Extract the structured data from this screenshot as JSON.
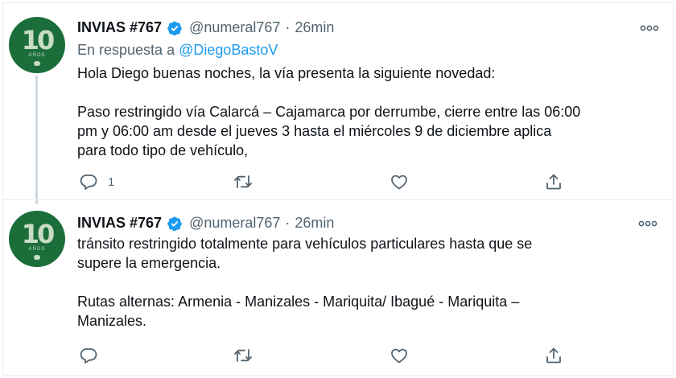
{
  "tweets": [
    {
      "author_name": "INVIAS #767",
      "handle": "@numeral767",
      "separator": "·",
      "time": "26min",
      "reply_prefix": "En respuesta a",
      "reply_mention": "@DiegoBastoV",
      "body_lines": [
        "Hola Diego buenas noches, la vía presenta la siguiente novedad:",
        "Paso restringido vía Calarcá – Cajamarca por derrumbe, cierre entre las 06:00",
        "pm y 06:00 am desde el jueves 3 hasta el miércoles 9 de diciembre aplica",
        "para todo tipo de vehículo,"
      ],
      "reply_count": "1",
      "avatar_text": "10",
      "avatar_subtext": "AÑOS"
    },
    {
      "author_name": "INVIAS #767",
      "handle": "@numeral767",
      "separator": "·",
      "time": "26min",
      "body_lines": [
        "tránsito restringido totalmente para vehículos particulares hasta que se",
        "supere la emergencia.",
        "Rutas alternas: Armenia - Manizales - Mariquita/ Ibagué - Mariquita –",
        "Manizales."
      ],
      "avatar_text": "10",
      "avatar_subtext": "AÑOS"
    }
  ],
  "icons": {
    "verified": "verified-badge-icon",
    "more": "more-dots-icon",
    "reply": "reply-icon",
    "retweet": "retweet-icon",
    "like": "heart-icon",
    "share": "share-icon"
  },
  "colors": {
    "accent": "#1d9bf0",
    "muted": "#536471",
    "text": "#0f1419",
    "avatar_bg": "#1b6e3a",
    "verified": "#1d9bf0"
  }
}
